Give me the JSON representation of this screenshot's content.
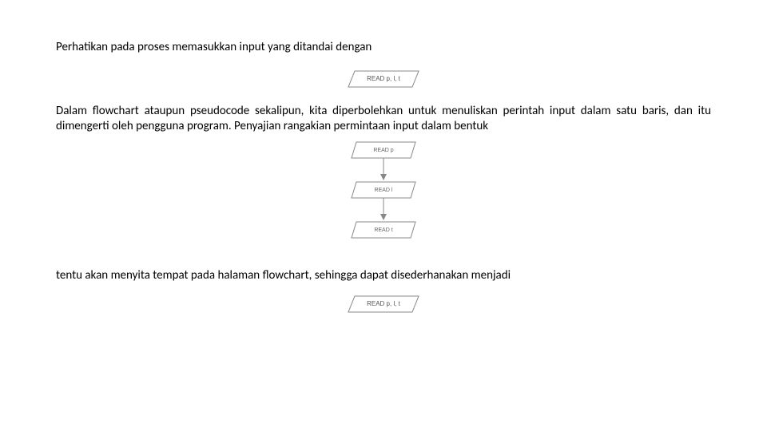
{
  "text": {
    "p1": "Perhatikan pada proses memasukkan input yang ditandai dengan",
    "p2": "Dalam flowchart ataupun pseudocode sekalipun, kita diperbolehkan untuk menuliskan perintah input dalam satu baris, dan itu dimengerti oleh pengguna program. Penyajian rangakian permintaan input dalam bentuk",
    "p3": "tentu akan menyita tempat pada halaman flowchart, sehingga dapat disederhanakan menjadi"
  },
  "chart_data": [
    {
      "type": "flowchart",
      "description": "single IO parallelogram",
      "nodes": [
        {
          "id": "n1",
          "shape": "parallelogram",
          "label": "READ p, l, t"
        }
      ],
      "edges": []
    },
    {
      "type": "flowchart",
      "description": "three stacked IO parallelograms connected by arrows",
      "nodes": [
        {
          "id": "a",
          "shape": "parallelogram",
          "label": "READ p"
        },
        {
          "id": "b",
          "shape": "parallelogram",
          "label": "READ l"
        },
        {
          "id": "c",
          "shape": "parallelogram",
          "label": "READ t"
        }
      ],
      "edges": [
        {
          "from": "a",
          "to": "b"
        },
        {
          "from": "b",
          "to": "c"
        }
      ]
    },
    {
      "type": "flowchart",
      "description": "single IO parallelogram (simplified form)",
      "nodes": [
        {
          "id": "s1",
          "shape": "parallelogram",
          "label": "READ p, l, t"
        }
      ],
      "edges": []
    }
  ]
}
